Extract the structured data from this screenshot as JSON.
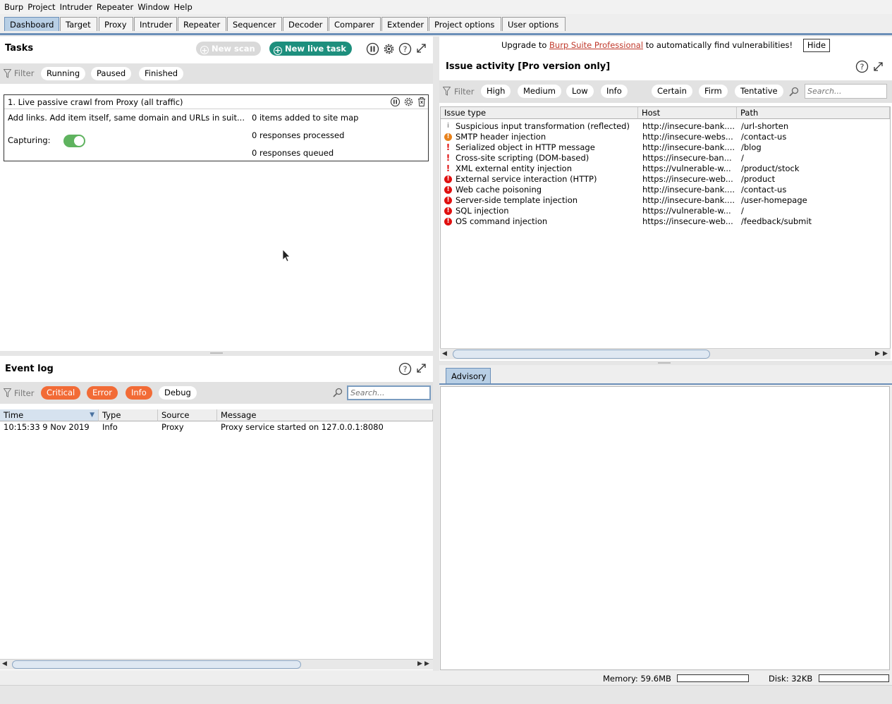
{
  "menu": [
    "Burp",
    "Project",
    "Intruder",
    "Repeater",
    "Window",
    "Help"
  ],
  "tabs": [
    "Dashboard",
    "Target",
    "Proxy",
    "Intruder",
    "Repeater",
    "Sequencer",
    "Decoder",
    "Comparer",
    "Extender",
    "Project options",
    "User options"
  ],
  "active_tab": "Dashboard",
  "tasks": {
    "title": "Tasks",
    "new_scan_label": "New scan",
    "new_live_task_label": "New live task",
    "filter_label": "Filter",
    "filters": [
      "Running",
      "Paused",
      "Finished"
    ],
    "task": {
      "name": "1. Live passive crawl from Proxy (all traffic)",
      "description": "Add links. Add item itself, same domain and URLs in suit...",
      "capturing_label": "Capturing:",
      "capturing_on": true,
      "stats": [
        "0 items added to site map",
        "0 responses processed",
        "0 responses queued"
      ]
    }
  },
  "event_log": {
    "title": "Event log",
    "filter_label": "Filter",
    "filters": [
      "Critical",
      "Error",
      "Info",
      "Debug"
    ],
    "active_filters": [
      "Critical",
      "Error",
      "Info"
    ],
    "search_placeholder": "Search...",
    "columns": [
      "Time",
      "Type",
      "Source",
      "Message"
    ],
    "rows": [
      {
        "time": "10:15:33 9 Nov 2019",
        "type": "Info",
        "source": "Proxy",
        "message": "Proxy service started on 127.0.0.1:8080"
      }
    ]
  },
  "upgrade": {
    "prefix": "Upgrade to",
    "link": "Burp Suite Professional",
    "suffix": "to automatically find vulnerabilities!",
    "hide_label": "Hide"
  },
  "issues": {
    "title": "Issue activity [Pro version only]",
    "filter_label": "Filter",
    "severity_filters": [
      "High",
      "Medium",
      "Low",
      "Info"
    ],
    "confidence_filters": [
      "Certain",
      "Firm",
      "Tentative"
    ],
    "search_placeholder": "Search...",
    "columns": [
      "Issue type",
      "Host",
      "Path"
    ],
    "rows": [
      {
        "severity": "info",
        "type": "Suspicious input transformation (reflected)",
        "host": "http://insecure-bank....",
        "path": "/url-shorten"
      },
      {
        "severity": "medium",
        "type": "SMTP header injection",
        "host": "http://insecure-webs...",
        "path": "/contact-us"
      },
      {
        "severity": "high-plain",
        "type": "Serialized object in HTTP message",
        "host": "http://insecure-bank....",
        "path": "/blog"
      },
      {
        "severity": "high-plain",
        "type": "Cross-site scripting (DOM-based)",
        "host": "https://insecure-ban...",
        "path": "/"
      },
      {
        "severity": "high-plain",
        "type": "XML external entity injection",
        "host": "https://vulnerable-w...",
        "path": "/product/stock"
      },
      {
        "severity": "high",
        "type": "External service interaction (HTTP)",
        "host": "https://insecure-web...",
        "path": "/product"
      },
      {
        "severity": "high",
        "type": "Web cache poisoning",
        "host": "http://insecure-bank....",
        "path": "/contact-us"
      },
      {
        "severity": "high",
        "type": "Server-side template injection",
        "host": "http://insecure-bank....",
        "path": "/user-homepage"
      },
      {
        "severity": "high",
        "type": "SQL injection",
        "host": "https://vulnerable-w...",
        "path": "/"
      },
      {
        "severity": "high",
        "type": "OS command injection",
        "host": "https://insecure-web...",
        "path": "/feedback/submit"
      }
    ]
  },
  "advisory_tab": "Advisory",
  "status": {
    "memory": "Memory: 59.6MB",
    "disk": "Disk: 32KB"
  },
  "colors": {
    "accent_green": "#1d8f7d",
    "filter_orange": "#f26b36",
    "tab_active": "#b8cfe5",
    "severity_high": "#e01010",
    "severity_medium": "#e8821c"
  }
}
